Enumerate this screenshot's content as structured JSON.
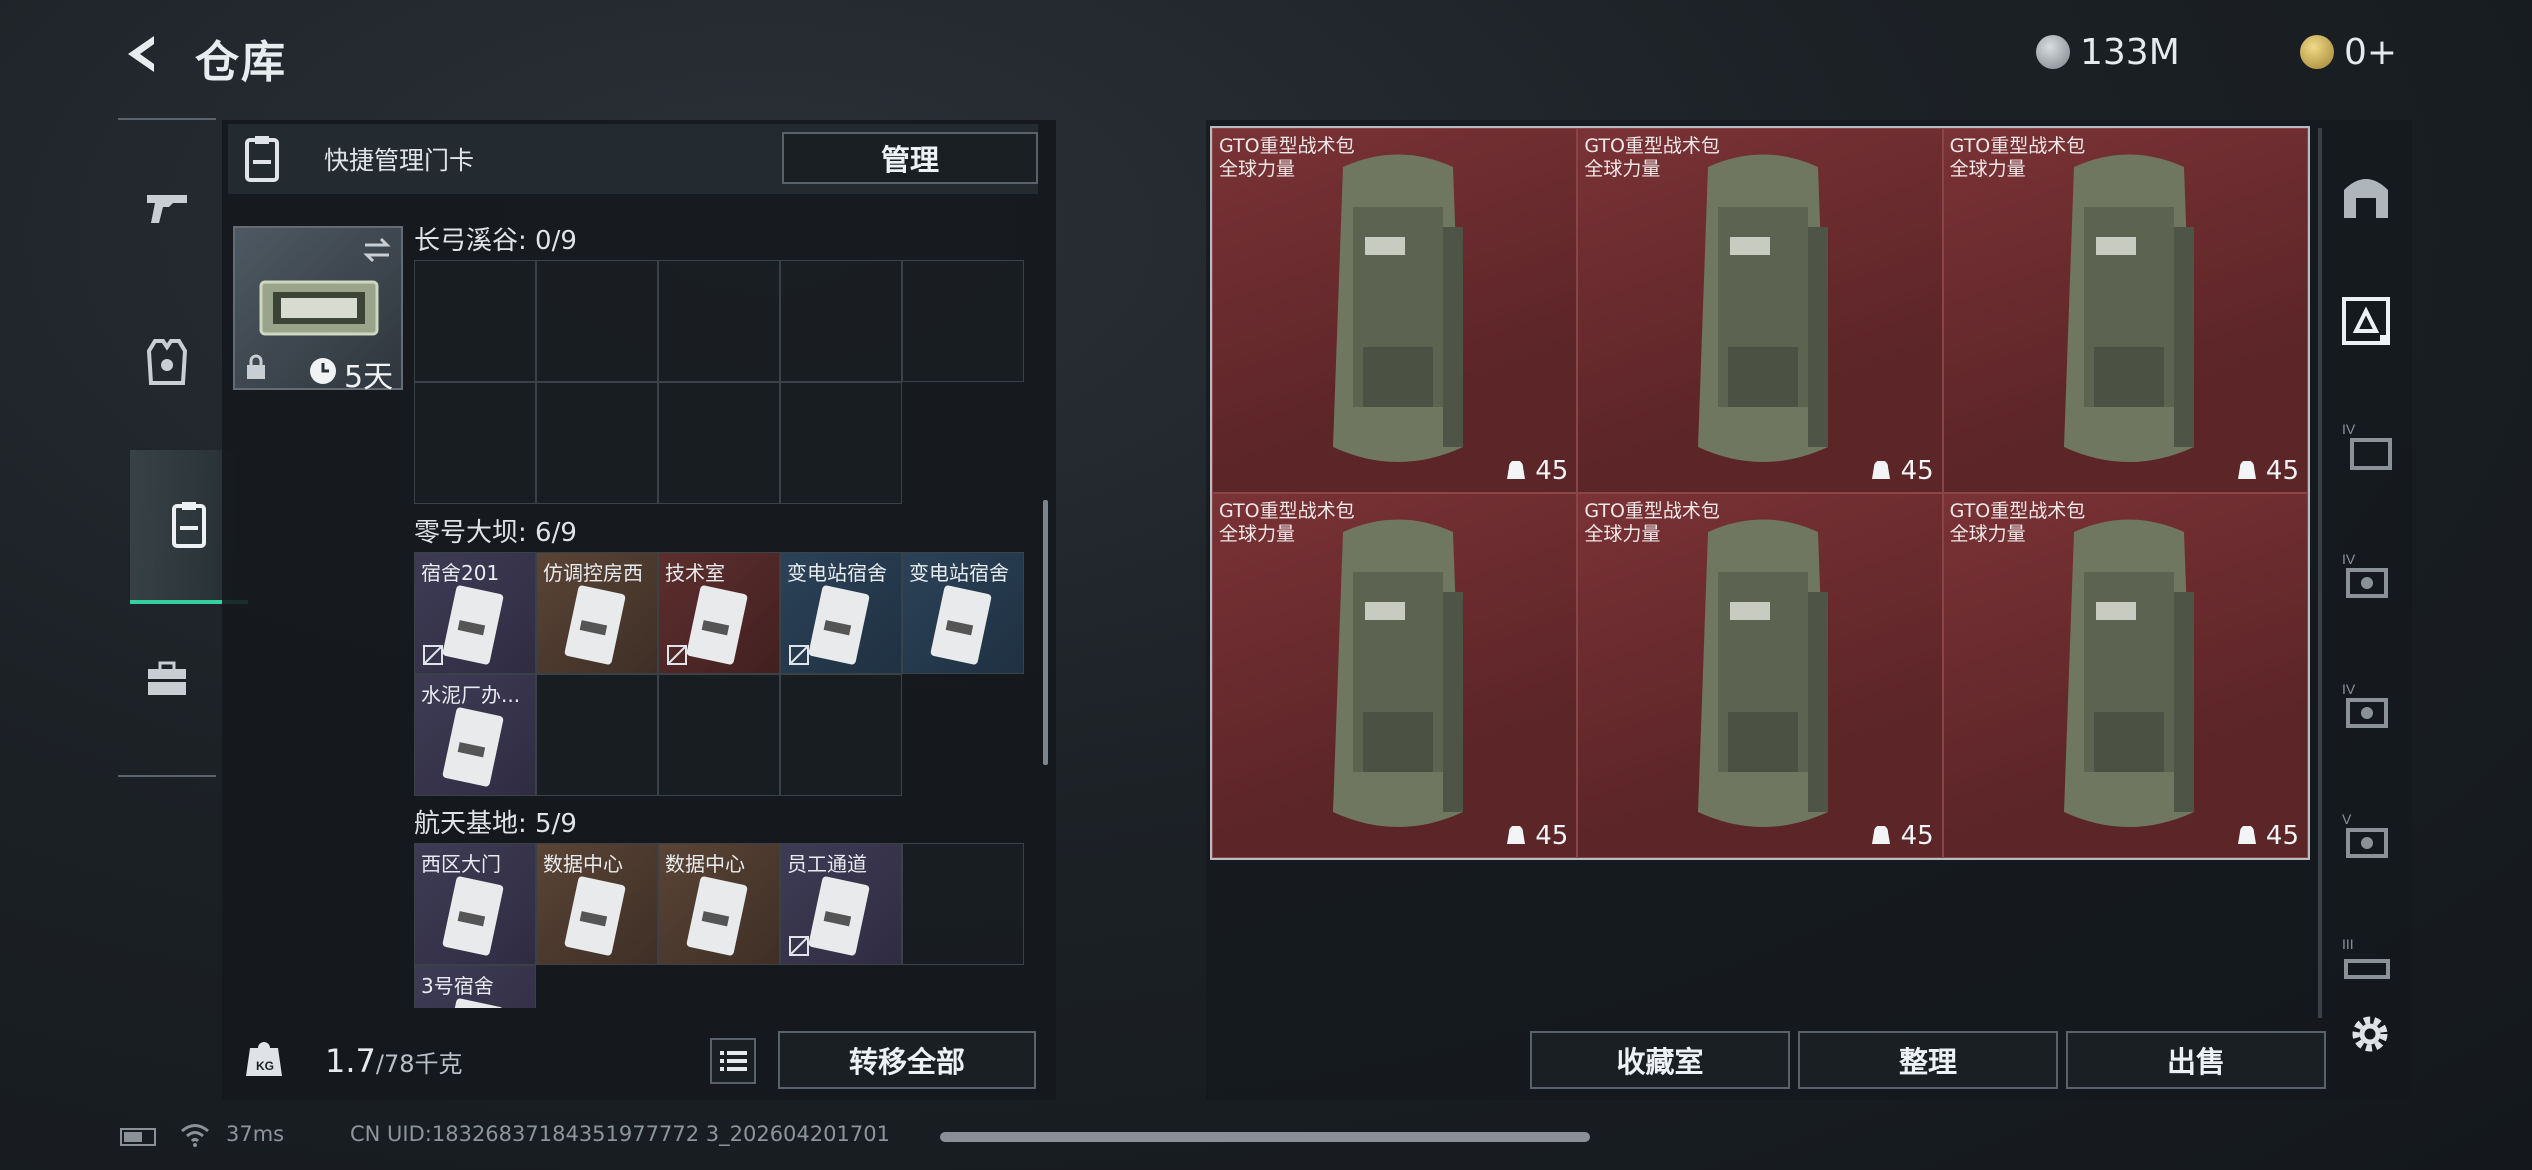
{
  "header": {
    "title": "仓库",
    "currency": [
      {
        "icon": "silver-coin-icon",
        "value": "133M"
      },
      {
        "icon": "gold-coin-icon",
        "value": "0+"
      }
    ]
  },
  "left_nav": {
    "items": [
      {
        "name": "weapons",
        "icon": "pistol-icon"
      },
      {
        "name": "equipment",
        "icon": "vest-icon"
      },
      {
        "name": "keycards",
        "icon": "keycard-icon",
        "active": true
      },
      {
        "name": "supplies",
        "icon": "toolbox-icon"
      }
    ]
  },
  "quick_manage": {
    "title": "快捷管理门卡",
    "manage_label": "管理",
    "keycard_days": "5天"
  },
  "zones": [
    {
      "label": "长弓溪谷: 0/9",
      "cards": []
    },
    {
      "label": "零号大坝: 6/9",
      "cards": [
        {
          "name": "宿舍201",
          "color": "purple"
        },
        {
          "name": "仿调控房西",
          "color": "orange"
        },
        {
          "name": "技术室",
          "color": "red"
        },
        {
          "name": "变电站宿舍",
          "color": "blue"
        },
        {
          "name": "变电站宿舍",
          "color": "blue"
        },
        {
          "name": "水泥厂办...",
          "color": "purple"
        }
      ]
    },
    {
      "label": "航天基地: 5/9",
      "cards": [
        {
          "name": "西区大门",
          "color": "purple"
        },
        {
          "name": "数据中心",
          "color": "orange"
        },
        {
          "name": "数据中心",
          "color": "orange"
        },
        {
          "name": "员工通道",
          "color": "purple"
        },
        {
          "name": "3号宿舍",
          "color": "purple"
        }
      ]
    }
  ],
  "weight": {
    "current": "1.7",
    "max": "/78千克"
  },
  "transfer_all_label": "转移全部",
  "stash_items": [
    {
      "name": "GTO重型战术包",
      "subtitle": "全球力量",
      "count": "45"
    },
    {
      "name": "GTO重型战术包",
      "subtitle": "全球力量",
      "count": "45"
    },
    {
      "name": "GTO重型战术包",
      "subtitle": "全球力量",
      "count": "45"
    },
    {
      "name": "GTO重型战术包",
      "subtitle": "全球力量",
      "count": "45"
    },
    {
      "name": "GTO重型战术包",
      "subtitle": "全球力量",
      "count": "45"
    },
    {
      "name": "GTO重型战术包",
      "subtitle": "全球力量",
      "count": "45"
    }
  ],
  "bottom_buttons": {
    "collection": "收藏室",
    "organize": "整理",
    "sell": "出售"
  },
  "right_nav": [
    "vault-icon",
    "tier-v-storage-icon",
    "tier-iv-storage-icon",
    "tier-iv-camera-icon",
    "tier-iv-camera-icon",
    "tier-v-camera-icon",
    "tier-iii-storage-icon",
    "settings-icon"
  ],
  "footer": {
    "ping": "37ms",
    "uid": "CN UID:18326837184351977772 3_202604201701"
  }
}
